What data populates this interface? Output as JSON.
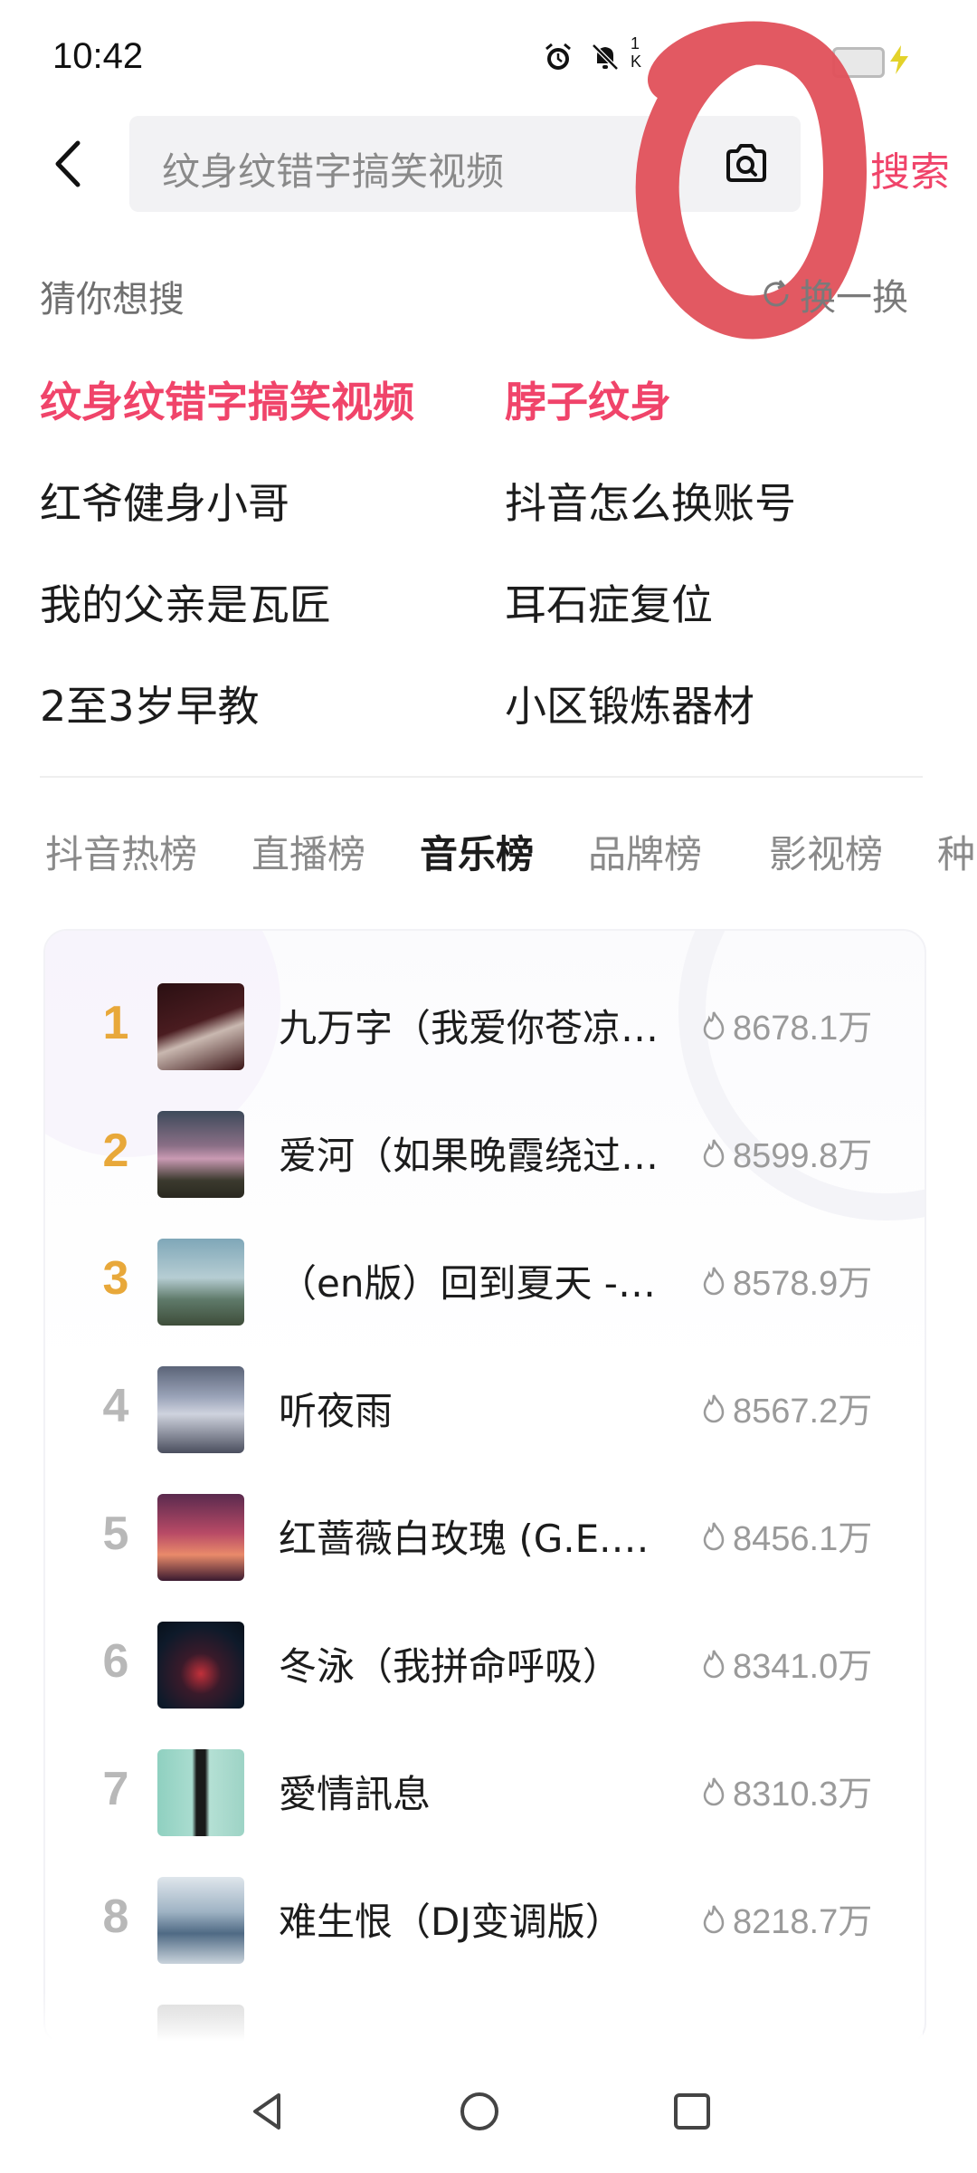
{
  "status": {
    "time": "10:42",
    "kb_top": "1",
    "kb_bottom": "K",
    "icons": [
      "alarm-icon",
      "mute-icon",
      "signal-icon",
      "battery-icon",
      "charging-icon"
    ]
  },
  "search": {
    "placeholder": "纹身纹错字搞笑视频",
    "submit_label": "搜索"
  },
  "guess": {
    "heading": "猜你想搜",
    "refresh_label": "换一换",
    "suggestions": [
      {
        "text": "纹身纹错字搞笑视频",
        "hot": true
      },
      {
        "text": "脖子纹身",
        "hot": true
      },
      {
        "text": "红爷健身小哥",
        "hot": false
      },
      {
        "text": "抖音怎么换账号",
        "hot": false
      },
      {
        "text": "我的父亲是瓦匠",
        "hot": false
      },
      {
        "text": "耳石症复位",
        "hot": false
      },
      {
        "text": "2至3岁早教",
        "hot": false
      },
      {
        "text": "小区锻炼器材",
        "hot": false
      }
    ]
  },
  "tabs": [
    {
      "label": "抖音热榜",
      "active": false
    },
    {
      "label": "直播榜",
      "active": false
    },
    {
      "label": "音乐榜",
      "active": true
    },
    {
      "label": "品牌榜",
      "active": false
    },
    {
      "label": "影视榜",
      "active": false
    },
    {
      "label": "种",
      "active": false
    }
  ],
  "music_chart": [
    {
      "rank": "1",
      "title": "九万字（我爱你苍凉…",
      "heat": "8678.1万"
    },
    {
      "rank": "2",
      "title": "爱河（如果晚霞绕过…",
      "heat": "8599.8万"
    },
    {
      "rank": "3",
      "title": "（en版）回到夏天 -…",
      "heat": "8578.9万"
    },
    {
      "rank": "4",
      "title": "听夜雨",
      "heat": "8567.2万"
    },
    {
      "rank": "5",
      "title": "红蔷薇白玫瑰 (G.E.…",
      "heat": "8456.1万"
    },
    {
      "rank": "6",
      "title": "冬泳（我拼命呼吸）",
      "heat": "8341.0万"
    },
    {
      "rank": "7",
      "title": "愛情訊息",
      "heat": "8310.3万"
    },
    {
      "rank": "8",
      "title": "难生恨（DJ变调版）",
      "heat": "8218.7万"
    }
  ],
  "colors": {
    "accent": "#f0446a",
    "rank_top": "#e8a83a",
    "circle_mark": "#e0505a"
  }
}
